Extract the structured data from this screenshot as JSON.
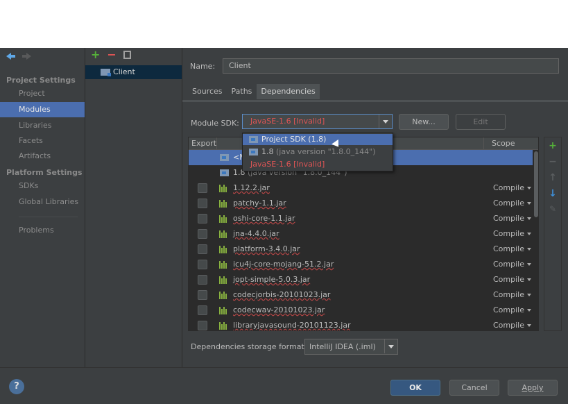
{
  "nav": {
    "section_project": "Project Settings",
    "project": "Project",
    "modules": "Modules",
    "libraries": "Libraries",
    "facets": "Facets",
    "artifacts": "Artifacts",
    "section_platform": "Platform Settings",
    "sdks": "SDKs",
    "global_libraries": "Global Libraries",
    "problems": "Problems"
  },
  "modules": {
    "items": [
      "Client"
    ]
  },
  "main": {
    "name_label": "Name:",
    "name_value": "Client",
    "tabs": [
      "Sources",
      "Paths",
      "Dependencies"
    ],
    "sdk_label": "Module SDK:",
    "sdk_value": "JavaSE-1.6 [Invalid]",
    "new_button": "New...",
    "edit_button": "Edit",
    "export_header": "Export",
    "scope_header": "Scope",
    "storage_label": "Dependencies storage format:",
    "storage_value": "IntelliJ IDEA (.iml)"
  },
  "popup": {
    "items": [
      "Project SDK (1.8)",
      "1.8",
      "(java version \"1.8.0_144\")",
      "JavaSE-1.6 [Invalid]"
    ]
  },
  "table": {
    "row_selected_text": "<M",
    "sdk_row_name": "1.8",
    "sdk_row_version": "(java version \"1.8.0_144\")",
    "jars": [
      {
        "name": "1.12.2.jar",
        "scope": "Compile"
      },
      {
        "name": "patchy-1.1.jar",
        "scope": "Compile"
      },
      {
        "name": "oshi-core-1.1.jar",
        "scope": "Compile"
      },
      {
        "name": "jna-4.4.0.jar",
        "scope": "Compile"
      },
      {
        "name": "platform-3.4.0.jar",
        "scope": "Compile"
      },
      {
        "name": "icu4j-core-mojang-51.2.jar",
        "scope": "Compile"
      },
      {
        "name": "jopt-simple-5.0.3.jar",
        "scope": "Compile"
      },
      {
        "name": "codecjorbis-20101023.jar",
        "scope": "Compile"
      },
      {
        "name": "codecwav-20101023.jar",
        "scope": "Compile"
      },
      {
        "name": "libraryjavasound-20101123.jar",
        "scope": "Compile"
      }
    ]
  },
  "footer": {
    "help": "?",
    "ok": "OK",
    "cancel": "Cancel",
    "apply": "Apply"
  },
  "colors": {
    "accent": "#4b6eaf",
    "invalid": "#e05555",
    "add": "#55b13a"
  }
}
